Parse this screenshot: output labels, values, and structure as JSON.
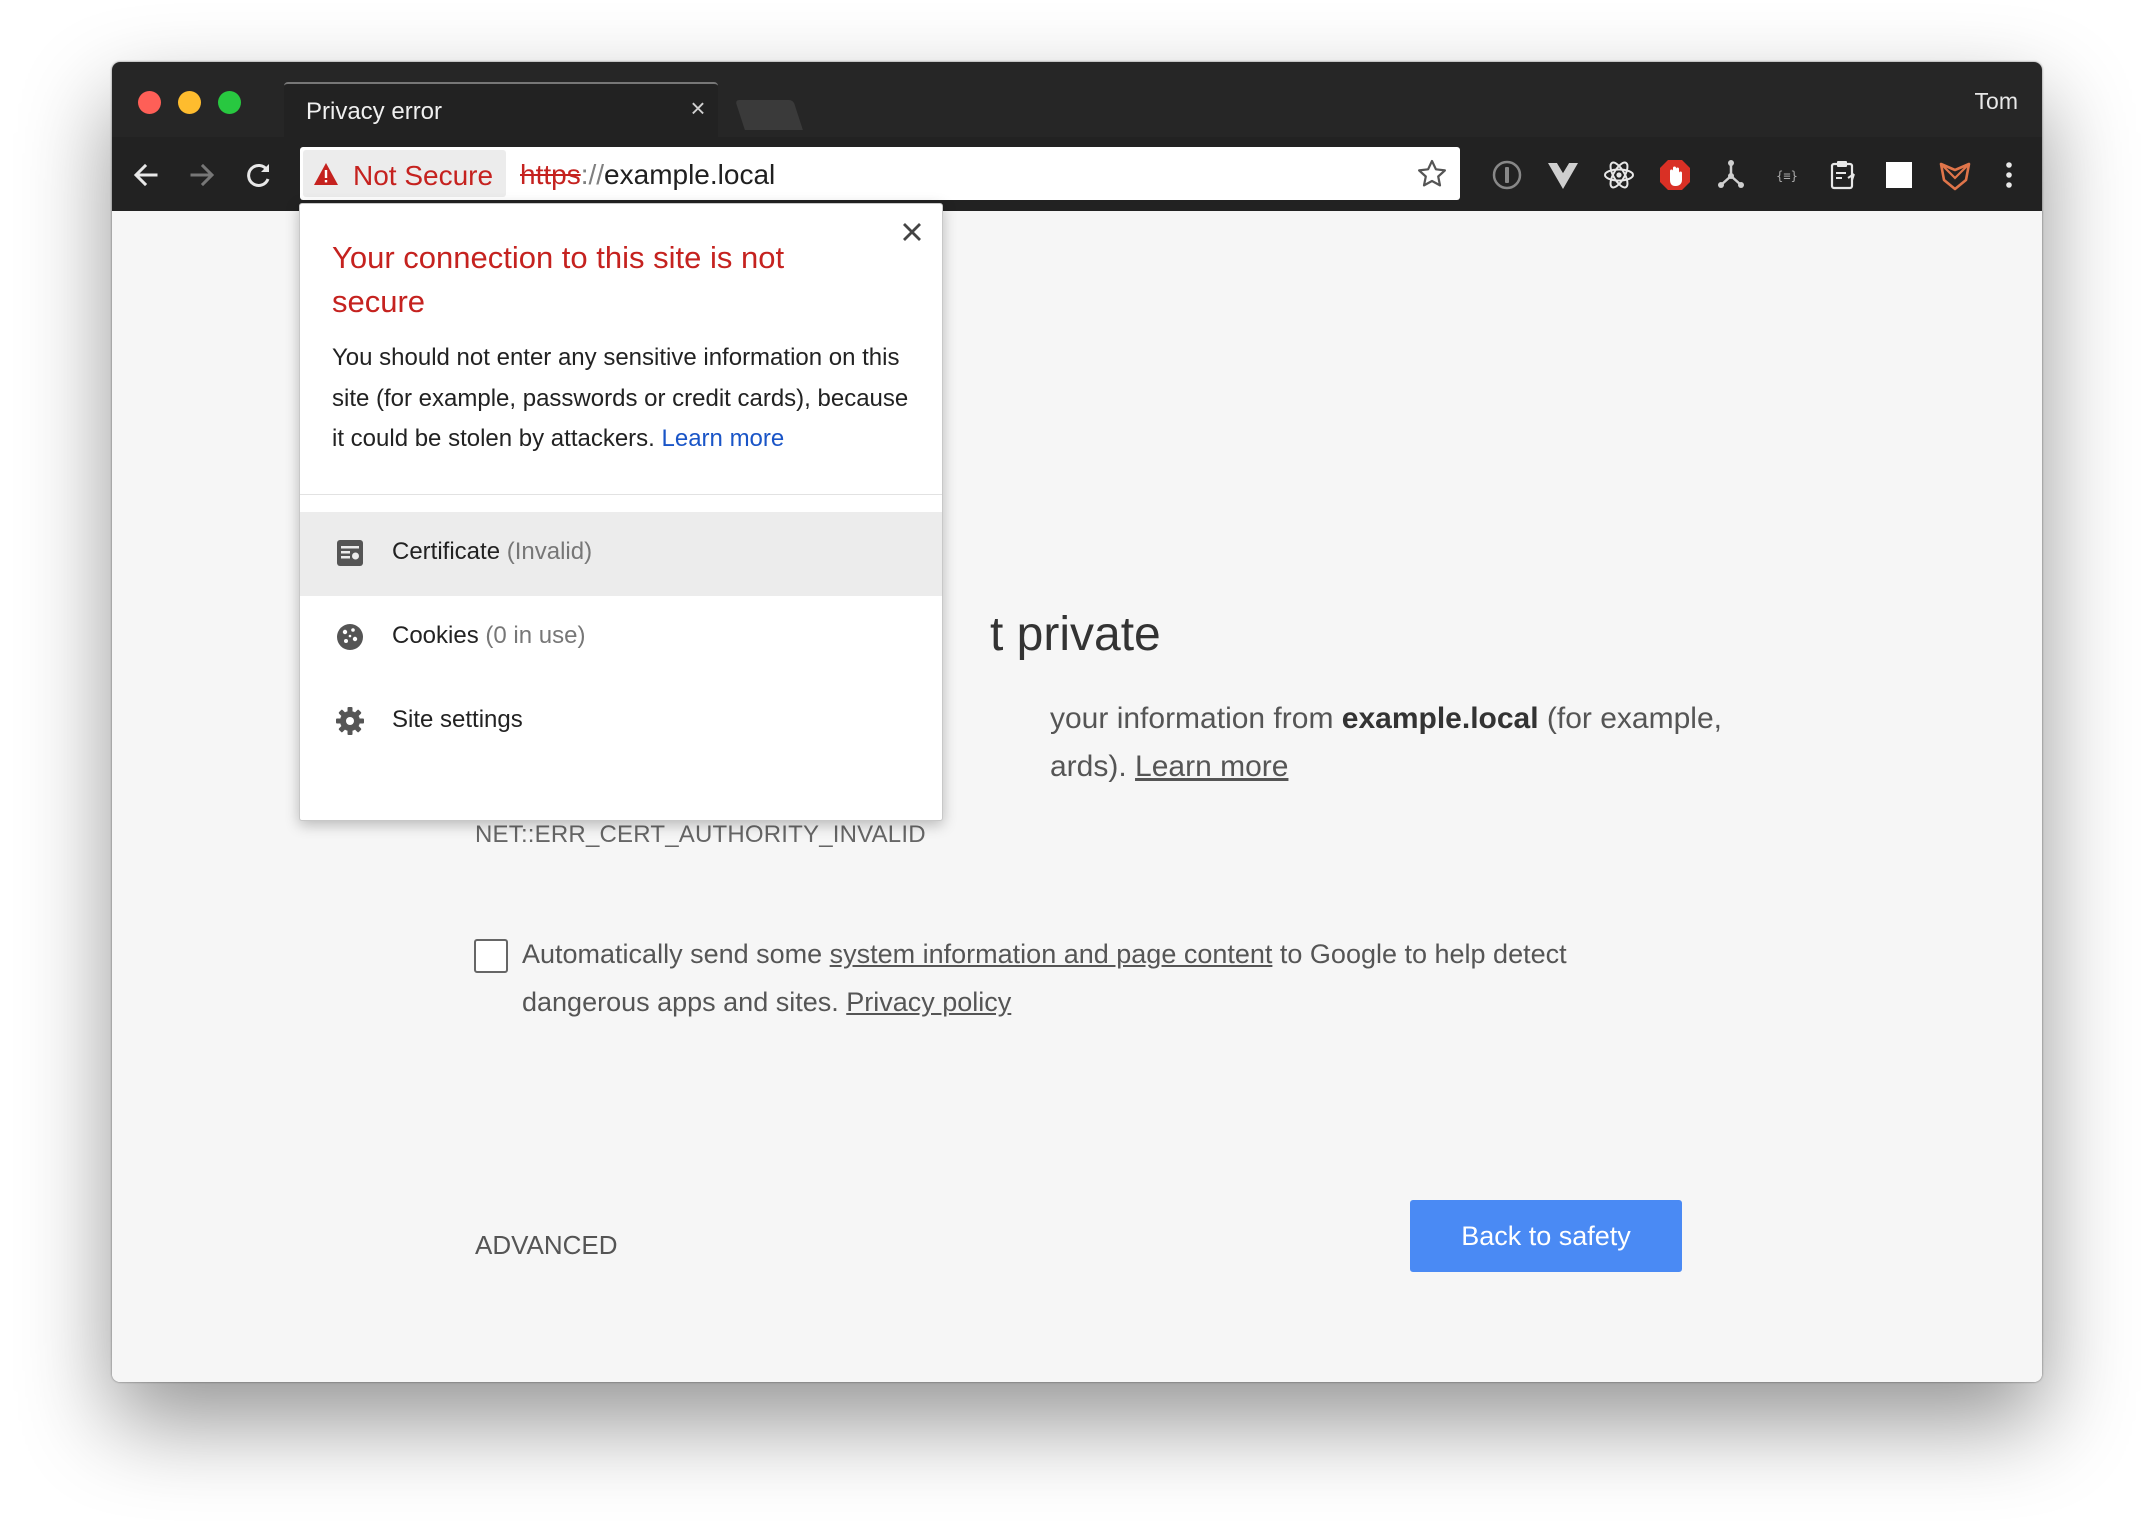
{
  "browser": {
    "tab_title": "Privacy error",
    "profile_name": "Tom",
    "security_chip": "Not Secure",
    "url": {
      "scheme": "https",
      "separator": "://",
      "host": "example.local"
    }
  },
  "popup": {
    "title": "Your connection to this site is not secure",
    "body_text": "You should not enter any sensitive information on this site (for example, passwords or credit cards), because it could be stolen by attackers.",
    "learn_more": "Learn more",
    "rows": [
      {
        "label": "Certificate",
        "sub": "(Invalid)",
        "icon": "certificate-icon"
      },
      {
        "label": "Cookies",
        "sub": "(0 in use)",
        "icon": "cookie-icon"
      },
      {
        "label": "Site settings",
        "sub": "",
        "icon": "gear-icon"
      }
    ]
  },
  "page": {
    "heading_visible": "t private",
    "para1_pre": "your information from ",
    "para1_host": "example.local",
    "para1_post": " (for example,",
    "para2_pre": "ards). ",
    "learn_more": "Learn more",
    "error_code": "NET::ERR_CERT_AUTHORITY_INVALID",
    "checkbox_pre": "Automatically send some ",
    "checkbox_link": "system information and page content",
    "checkbox_post": " to Google to help detect",
    "checkbox_line2": "dangerous apps and sites. ",
    "privacy_policy": "Privacy policy",
    "advanced_label": "ADVANCED",
    "back_button": "Back to safety"
  },
  "colors": {
    "accent_button": "#4a8af4",
    "warning_red": "#c5221f",
    "link_blue": "#1a55c7"
  }
}
